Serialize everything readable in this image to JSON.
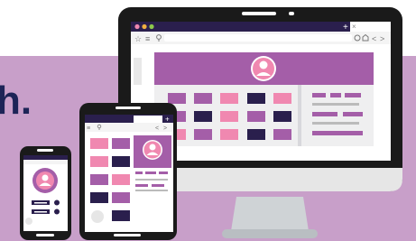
{
  "headline": {
    "text": "h."
  },
  "colors": {
    "band": "#c89fc9",
    "navy": "#2a1f4d",
    "purple": "#a45ea8",
    "pink": "#f088b0",
    "device_black": "#1a1a1a",
    "bezel_gray": "#e6e6e6",
    "headline": "#1d2457"
  },
  "browser": {
    "close_glyph": "×",
    "new_tab_glyph": "+",
    "nav_glyphs": [
      "<",
      ">"
    ]
  },
  "icons": [
    "star-icon",
    "menu-icon",
    "search-icon",
    "user-avatar-icon",
    "home-icon",
    "refresh-icon",
    "plus-icon",
    "close-icon"
  ]
}
